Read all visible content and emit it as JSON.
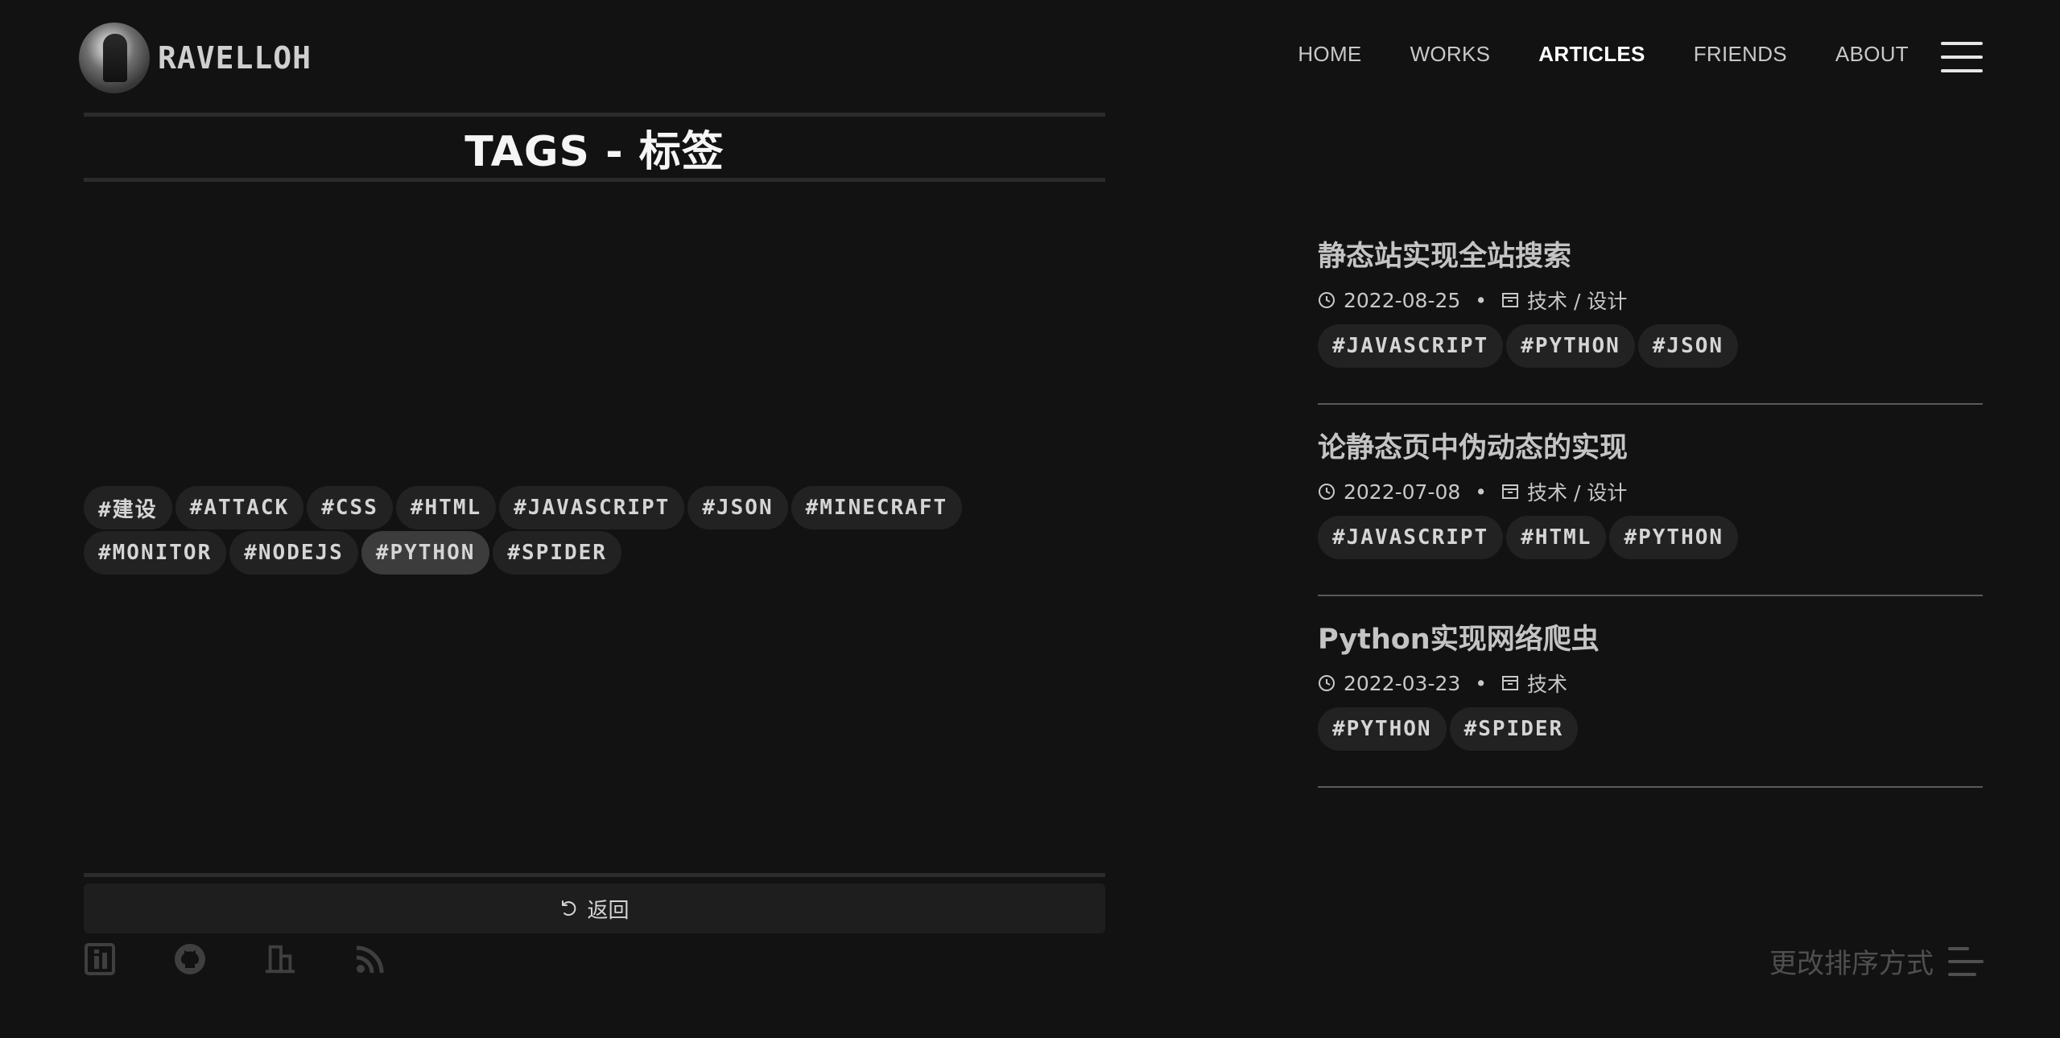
{
  "brand": {
    "name": "RAVELLOH"
  },
  "nav": {
    "items": [
      {
        "label": "HOME",
        "active": false
      },
      {
        "label": "WORKS",
        "active": false
      },
      {
        "label": "ARTICLES",
        "active": true
      },
      {
        "label": "FRIENDS",
        "active": false
      },
      {
        "label": "ABOUT",
        "active": false
      }
    ]
  },
  "page": {
    "title": "TAGS - 标签"
  },
  "tag_cloud": {
    "tags": [
      "#建设",
      "#ATTACK",
      "#CSS",
      "#HTML",
      "#JAVASCRIPT",
      "#JSON",
      "#MINECRAFT",
      "#MONITOR",
      "#NODEJS",
      "#PYTHON",
      "#SPIDER"
    ],
    "selected": "#PYTHON"
  },
  "back": {
    "label": "返回"
  },
  "social": {
    "icons": [
      "info-icon",
      "github-icon",
      "building-icon",
      "rss-icon"
    ]
  },
  "articles": [
    {
      "title": "静态站实现全站搜索",
      "date": "2022-08-25",
      "category": "技术 / 设计",
      "tags": [
        "#JAVASCRIPT",
        "#PYTHON",
        "#JSON"
      ]
    },
    {
      "title": "论静态页中伪动态的实现",
      "date": "2022-07-08",
      "category": "技术 / 设计",
      "tags": [
        "#JAVASCRIPT",
        "#HTML",
        "#PYTHON"
      ]
    },
    {
      "title": "Python实现网络爬虫",
      "date": "2022-03-23",
      "category": "技术",
      "tags": [
        "#PYTHON",
        "#SPIDER"
      ]
    }
  ],
  "sort": {
    "label": "更改排序方式"
  },
  "colors": {
    "background": "#121212",
    "tag_bg": "#222222",
    "tag_selected_bg": "#3c3c3c",
    "divider": "#2b2b2b"
  }
}
